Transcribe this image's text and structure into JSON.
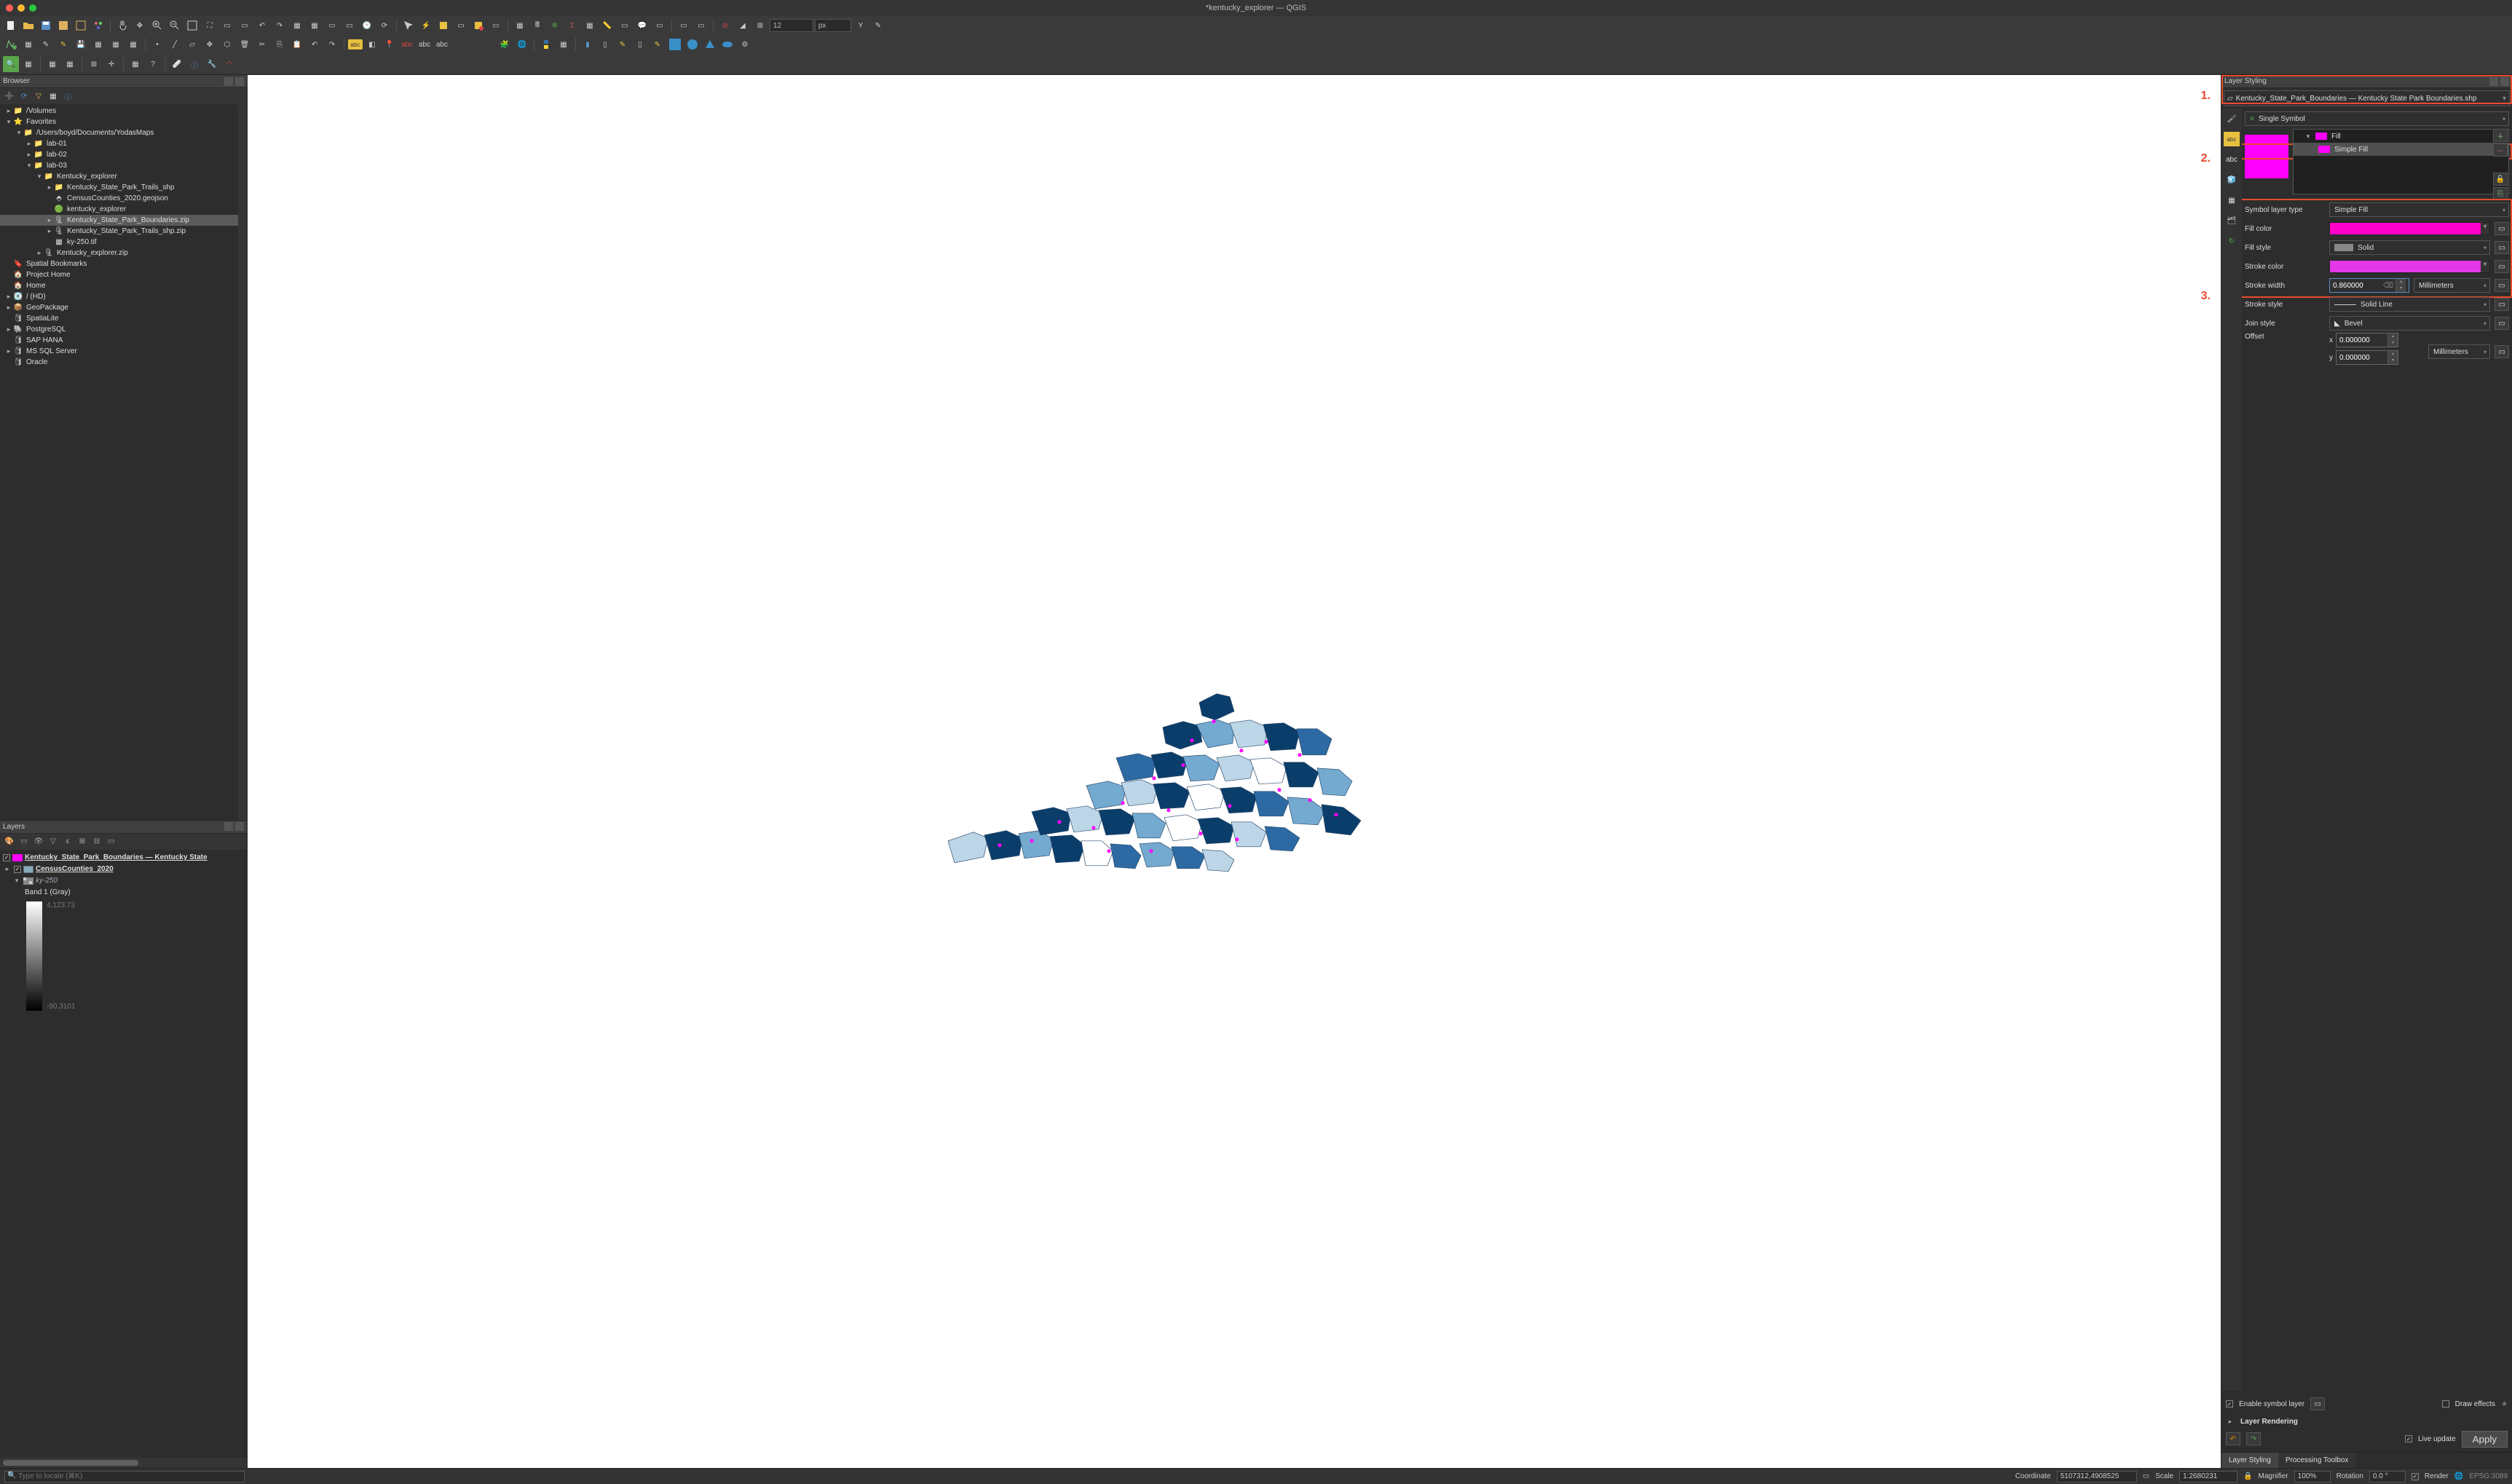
{
  "window_title": "*kentucky_explorer — QGIS",
  "toolboxes": {
    "numeric_input": "12",
    "unit": "px"
  },
  "browser": {
    "title": "Browser",
    "tree": [
      {
        "d": 0,
        "exp": "▸",
        "icon": "folder",
        "label": "/Volumes"
      },
      {
        "d": 0,
        "exp": "▾",
        "icon": "star",
        "label": "Favorites"
      },
      {
        "d": 1,
        "exp": "▾",
        "icon": "folder",
        "label": "/Users/boyd/Documents/YodasMaps"
      },
      {
        "d": 2,
        "exp": "▸",
        "icon": "folder",
        "label": "lab-01"
      },
      {
        "d": 2,
        "exp": "▸",
        "icon": "folder",
        "label": "lab-02"
      },
      {
        "d": 2,
        "exp": "▾",
        "icon": "folder",
        "label": "lab-03"
      },
      {
        "d": 3,
        "exp": "▾",
        "icon": "folder",
        "label": "Kentucky_explorer"
      },
      {
        "d": 4,
        "exp": "▸",
        "icon": "folder",
        "label": "Kentucky_State_Park_Trails_shp"
      },
      {
        "d": 4,
        "exp": "",
        "icon": "geojson",
        "label": "CensusCounties_2020.geojson"
      },
      {
        "d": 4,
        "exp": "",
        "icon": "qgis",
        "label": "kentucky_explorer"
      },
      {
        "d": 4,
        "exp": "▸",
        "icon": "zip",
        "label": "Kentucky_State_Park_Boundaries.zip",
        "sel": true
      },
      {
        "d": 4,
        "exp": "▸",
        "icon": "zip",
        "label": "Kentucky_State_Park_Trails_shp.zip"
      },
      {
        "d": 4,
        "exp": "",
        "icon": "raster",
        "label": "ky-250.tif"
      },
      {
        "d": 3,
        "exp": "▸",
        "icon": "zip",
        "label": "Kentucky_explorer.zip"
      },
      {
        "d": 0,
        "exp": "",
        "icon": "bookmark",
        "label": "Spatial Bookmarks"
      },
      {
        "d": 0,
        "exp": "",
        "icon": "home",
        "label": "Project Home"
      },
      {
        "d": 0,
        "exp": "",
        "icon": "home",
        "label": "Home"
      },
      {
        "d": 0,
        "exp": "▸",
        "icon": "disk",
        "label": "/ (HD)"
      },
      {
        "d": 0,
        "exp": "▸",
        "icon": "gpkg",
        "label": "GeoPackage"
      },
      {
        "d": 0,
        "exp": "",
        "icon": "db",
        "label": "SpatiaLite"
      },
      {
        "d": 0,
        "exp": "▸",
        "icon": "pg",
        "label": "PostgreSQL"
      },
      {
        "d": 0,
        "exp": "",
        "icon": "db",
        "label": "SAP HANA"
      },
      {
        "d": 0,
        "exp": "▸",
        "icon": "db",
        "label": "MS SQL Server"
      },
      {
        "d": 0,
        "exp": "",
        "icon": "db",
        "label": "Oracle"
      }
    ]
  },
  "layers": {
    "title": "Layers",
    "items": [
      {
        "checked": true,
        "swatch": "#ff00ff",
        "label": "Kentucky_State_Park_Boundaries — Kentucky State",
        "bold": true
      },
      {
        "checked": true,
        "swatch": "poly",
        "label": "CensusCounties_2020",
        "bold": true,
        "exp": "▸"
      },
      {
        "checked": false,
        "swatch": "raster",
        "label": "ky-250",
        "italic": true,
        "exp": "▾"
      }
    ],
    "band_label": "Band 1 (Gray)",
    "ramp_max": "4,123.73",
    "ramp_min": "-90.3101"
  },
  "layer_styling": {
    "title": "Layer Styling",
    "layer_name": "Kentucky_State_Park_Boundaries — Kentucky State Park Boundaries.shp",
    "renderer": "Single Symbol",
    "sym_tree": {
      "root": "Fill",
      "child": "Simple Fill"
    },
    "symbol_layer_type_label": "Symbol layer type",
    "symbol_layer_type": "Simple Fill",
    "props": {
      "fill_color_label": "Fill color",
      "fill_color": "#ff00c8",
      "fill_style_label": "Fill style",
      "fill_style": "Solid",
      "stroke_color_label": "Stroke color",
      "stroke_color": "#e438e8",
      "stroke_width_label": "Stroke width",
      "stroke_width": "0.860000",
      "stroke_width_unit": "Millimeters",
      "stroke_style_label": "Stroke style",
      "stroke_style": "Solid Line",
      "join_style_label": "Join style",
      "join_style": "Bevel",
      "offset_label": "Offset",
      "offset_x_label": "x",
      "offset_x": "0.000000",
      "offset_y_label": "y",
      "offset_y": "0.000000",
      "offset_unit": "Millimeters"
    },
    "enable_symbol_layer": "Enable symbol layer",
    "draw_effects": "Draw effects",
    "layer_rendering": "Layer Rendering",
    "live_update": "Live update",
    "apply": "Apply",
    "tabs": {
      "a": "Layer Styling",
      "b": "Processing Toolbox"
    }
  },
  "annotations": {
    "a1": "1.",
    "a2": "2.",
    "a3": "3."
  },
  "status": {
    "locator_placeholder": "Type to locate (⌘K)",
    "coordinate_label": "Coordinate",
    "coordinate": "5107312,4908525",
    "scale_label": "Scale",
    "scale": "1:2680231",
    "magnifier_label": "Magnifier",
    "magnifier": "100%",
    "rotation_label": "Rotation",
    "rotation": "0.0 °",
    "render": "Render",
    "crs": "EPSG:3089"
  },
  "colors": {
    "highlight": "#e84a2f",
    "pink": "#ff00ff"
  }
}
